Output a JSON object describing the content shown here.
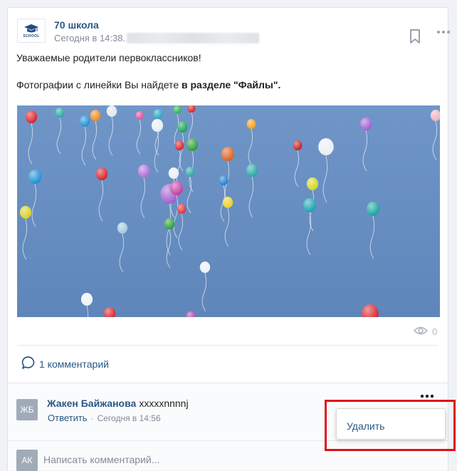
{
  "post": {
    "author": "70 школа",
    "school_label": "SCHOOL",
    "time": "Сегодня в 14:38.",
    "text_line1": "Уважаемые родители первоклассников!",
    "text_line2_plain": "Фотографии с линейки Вы найдете ",
    "text_line2_bold": "в разделе \"Файлы\".",
    "views": "0",
    "comments_count_label": "1 комментарий"
  },
  "comment": {
    "avatar_initials": "ЖБ",
    "author": "Жакен Байжанова",
    "text": "xxxxxnnnnj",
    "reply_label": "Ответить",
    "separator": "·",
    "time": "Сегодня в 14:56"
  },
  "composer": {
    "avatar_initials": "АК",
    "placeholder": "Написать комментарий..."
  },
  "menu": {
    "delete_label": "Удалить"
  },
  "colors": {
    "link": "#2a5885",
    "highlight_box": "#e01016",
    "sky": "#6b8ec0"
  },
  "icons": [
    "graduation-cap-icon",
    "bookmark-icon",
    "more-icon",
    "eye-icon",
    "comment-bubble-icon"
  ]
}
